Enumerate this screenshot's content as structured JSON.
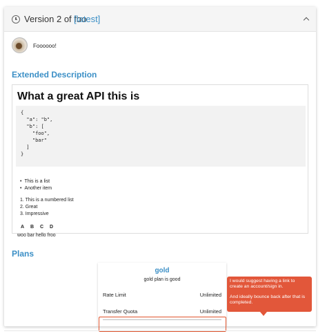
{
  "header": {
    "title": "Version 2 of foo",
    "badge": "[latest]"
  },
  "author": {
    "text": "Foooooo!"
  },
  "extended_description": {
    "section_title": "Extended Description",
    "heading": "What a great API this is",
    "code": "{\n  \"a\": \"b\",\n  \"b\": [\n    \"foo\",\n    \"bar\"\n  ]\n}",
    "bullet_list": [
      "This is a list",
      "Another item"
    ],
    "numbered_list": [
      "1. This is a numbered list",
      "2. Great",
      "3. Impressive"
    ],
    "table_headers": [
      "A",
      "B",
      "C",
      "D"
    ],
    "table_row": "woo bar hello froo"
  },
  "plans": {
    "section_title": "Plans",
    "card": {
      "name": "gold",
      "description": "gold plan is good",
      "rows": [
        {
          "label": "Rate Limit",
          "value": "Unlimited"
        },
        {
          "label": "Transfer Quota",
          "value": "Unlimited"
        }
      ]
    }
  },
  "annotation": {
    "line1": "I would suggest having a link to create an account/sign in.",
    "line2": "And ideally bounce  back after that is completed.",
    "accent_color": "#e2573a"
  },
  "colors": {
    "link_blue": "#3b8fc6",
    "header_bg": "#f5f5f5"
  },
  "icons": {
    "header_left": "clock-icon",
    "header_right": "chevron-up-icon"
  }
}
